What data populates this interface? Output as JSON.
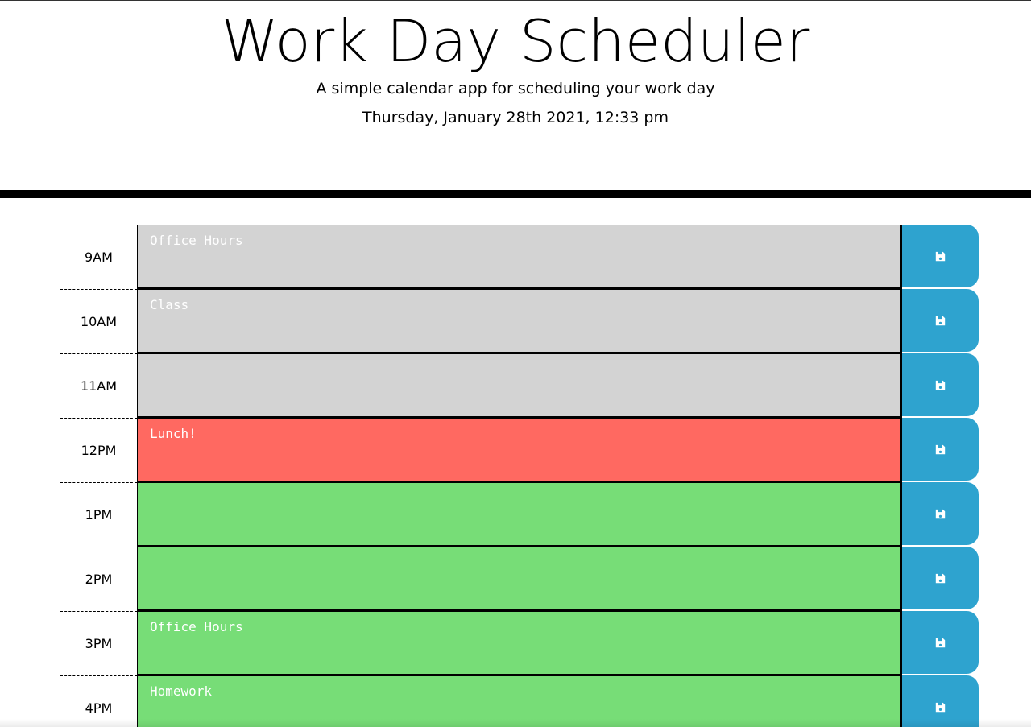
{
  "header": {
    "title": "Work Day Scheduler",
    "subtitle": "A simple calendar app for scheduling your work day",
    "current_day": "Thursday, January 28th 2021, 12:33 pm"
  },
  "colors": {
    "past": "#d3d3d3",
    "present": "#ff6961",
    "future": "#77dd77",
    "save_button": "#2ea3cf"
  },
  "time_blocks": [
    {
      "hour": "9AM",
      "text": "Office Hours",
      "status": "past",
      "save_icon": "save-icon"
    },
    {
      "hour": "10AM",
      "text": "Class",
      "status": "past",
      "save_icon": "save-icon"
    },
    {
      "hour": "11AM",
      "text": "",
      "status": "past",
      "save_icon": "save-icon"
    },
    {
      "hour": "12PM",
      "text": "Lunch!",
      "status": "present",
      "save_icon": "save-icon"
    },
    {
      "hour": "1PM",
      "text": "",
      "status": "future",
      "save_icon": "save-icon"
    },
    {
      "hour": "2PM",
      "text": "",
      "status": "future",
      "save_icon": "save-icon"
    },
    {
      "hour": "3PM",
      "text": "Office Hours",
      "status": "future",
      "save_icon": "save-icon"
    },
    {
      "hour": "4PM",
      "text": "Homework",
      "status": "future",
      "save_icon": "save-icon"
    }
  ]
}
